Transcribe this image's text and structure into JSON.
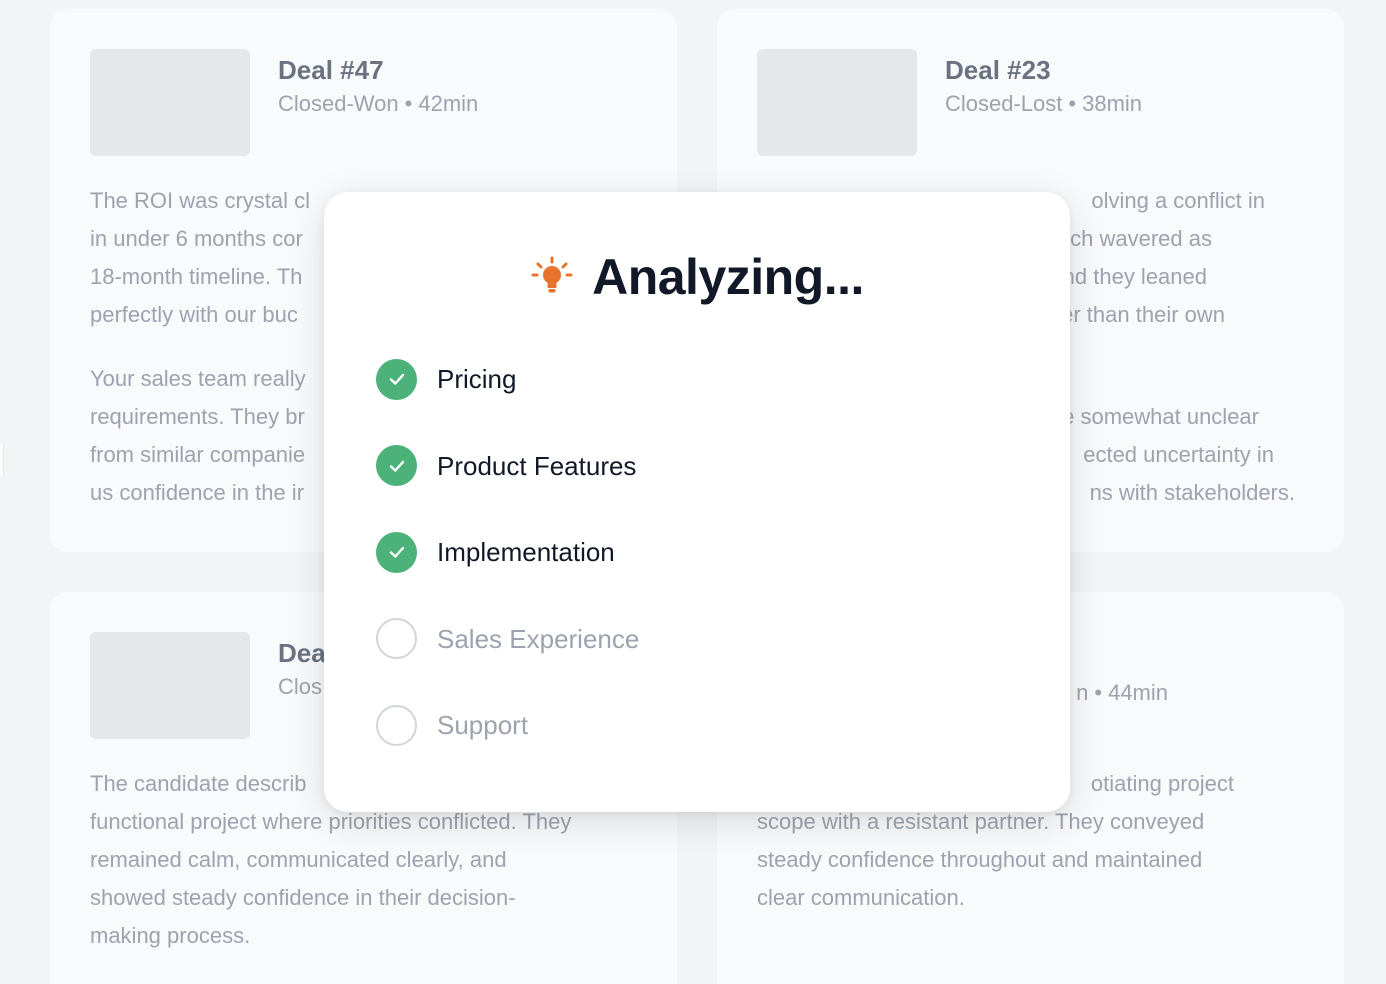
{
  "cards": [
    {
      "title": "Deal #47",
      "status": "Closed-Won",
      "separator": "•",
      "duration": "42min",
      "paragraphs": [
        "The ROI was crystal cl",
        "in under 6 months cor",
        "18-month timeline. Th",
        "perfectly with our buc",
        "Your sales team really",
        "requirements. They br",
        "from similar companie",
        "us confidence in the ir"
      ]
    },
    {
      "title": "Deal #23",
      "status": "Closed-Lost",
      "separator": "•",
      "duration": "38min",
      "paragraphs": [
        "olving a conflict in",
        "roach wavered as",
        "and they leaned",
        "her than their own",
        "re somewhat unclear",
        "ected uncertainty in",
        "ns with stakeholders."
      ]
    },
    {
      "title": "Dea",
      "status": "Clos",
      "paragraphs": [
        "The candidate describ",
        "functional project where priorities conflicted. They",
        "remained calm, communicated clearly, and",
        "showed steady confidence in their decision-",
        "making process."
      ]
    },
    {
      "status": "n",
      "separator": "•",
      "duration": "44min",
      "paragraphs": [
        "otiating project",
        "scope with a resistant partner. They conveyed",
        "steady confidence throughout and maintained",
        "clear communication."
      ]
    }
  ],
  "modal": {
    "title": "Analyzing...",
    "icon": "lightbulb-icon",
    "icon_color": "#e8732c",
    "check_color": "#4cb27a",
    "steps": [
      {
        "label": "Pricing",
        "state": "done"
      },
      {
        "label": "Product Features",
        "state": "done"
      },
      {
        "label": "Implementation",
        "state": "done"
      },
      {
        "label": "Sales Experience",
        "state": "pending"
      },
      {
        "label": "Support",
        "state": "pending"
      }
    ]
  }
}
